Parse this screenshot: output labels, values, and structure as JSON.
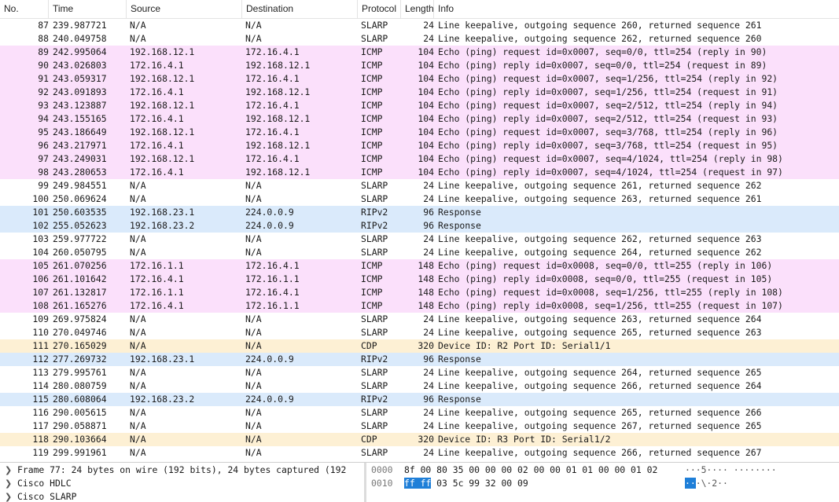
{
  "columns": {
    "no": "No.",
    "time": "Time",
    "source": "Source",
    "destination": "Destination",
    "protocol": "Protocol",
    "length": "Length",
    "info": "Info"
  },
  "colors": {
    "icmp": "#fbe0fb",
    "rip": "#daeafb",
    "cdp": "#fdf0d4",
    "slarp": "#ffffff",
    "selection": "#1f7fd8"
  },
  "packets": [
    {
      "no": "87",
      "time": "239.987721",
      "src": "N/A",
      "dst": "N/A",
      "proto": "SLARP",
      "len": "24",
      "info": "Line keepalive, outgoing sequence 260, returned sequence 261",
      "cls": "slarp"
    },
    {
      "no": "88",
      "time": "240.049758",
      "src": "N/A",
      "dst": "N/A",
      "proto": "SLARP",
      "len": "24",
      "info": "Line keepalive, outgoing sequence 262, returned sequence 260",
      "cls": "slarp"
    },
    {
      "no": "89",
      "time": "242.995064",
      "src": "192.168.12.1",
      "dst": "172.16.4.1",
      "proto": "ICMP",
      "len": "104",
      "info": "Echo (ping) request  id=0x0007, seq=0/0, ttl=254 (reply in 90)",
      "cls": "icmp"
    },
    {
      "no": "90",
      "time": "243.026803",
      "src": "172.16.4.1",
      "dst": "192.168.12.1",
      "proto": "ICMP",
      "len": "104",
      "info": "Echo (ping) reply    id=0x0007, seq=0/0, ttl=254 (request in 89)",
      "cls": "icmp"
    },
    {
      "no": "91",
      "time": "243.059317",
      "src": "192.168.12.1",
      "dst": "172.16.4.1",
      "proto": "ICMP",
      "len": "104",
      "info": "Echo (ping) request  id=0x0007, seq=1/256, ttl=254 (reply in 92)",
      "cls": "icmp"
    },
    {
      "no": "92",
      "time": "243.091893",
      "src": "172.16.4.1",
      "dst": "192.168.12.1",
      "proto": "ICMP",
      "len": "104",
      "info": "Echo (ping) reply    id=0x0007, seq=1/256, ttl=254 (request in 91)",
      "cls": "icmp"
    },
    {
      "no": "93",
      "time": "243.123887",
      "src": "192.168.12.1",
      "dst": "172.16.4.1",
      "proto": "ICMP",
      "len": "104",
      "info": "Echo (ping) request  id=0x0007, seq=2/512, ttl=254 (reply in 94)",
      "cls": "icmp"
    },
    {
      "no": "94",
      "time": "243.155165",
      "src": "172.16.4.1",
      "dst": "192.168.12.1",
      "proto": "ICMP",
      "len": "104",
      "info": "Echo (ping) reply    id=0x0007, seq=2/512, ttl=254 (request in 93)",
      "cls": "icmp"
    },
    {
      "no": "95",
      "time": "243.186649",
      "src": "192.168.12.1",
      "dst": "172.16.4.1",
      "proto": "ICMP",
      "len": "104",
      "info": "Echo (ping) request  id=0x0007, seq=3/768, ttl=254 (reply in 96)",
      "cls": "icmp"
    },
    {
      "no": "96",
      "time": "243.217971",
      "src": "172.16.4.1",
      "dst": "192.168.12.1",
      "proto": "ICMP",
      "len": "104",
      "info": "Echo (ping) reply    id=0x0007, seq=3/768, ttl=254 (request in 95)",
      "cls": "icmp"
    },
    {
      "no": "97",
      "time": "243.249031",
      "src": "192.168.12.1",
      "dst": "172.16.4.1",
      "proto": "ICMP",
      "len": "104",
      "info": "Echo (ping) request  id=0x0007, seq=4/1024, ttl=254 (reply in 98)",
      "cls": "icmp"
    },
    {
      "no": "98",
      "time": "243.280653",
      "src": "172.16.4.1",
      "dst": "192.168.12.1",
      "proto": "ICMP",
      "len": "104",
      "info": "Echo (ping) reply    id=0x0007, seq=4/1024, ttl=254 (request in 97)",
      "cls": "icmp"
    },
    {
      "no": "99",
      "time": "249.984551",
      "src": "N/A",
      "dst": "N/A",
      "proto": "SLARP",
      "len": "24",
      "info": "Line keepalive, outgoing sequence 261, returned sequence 262",
      "cls": "slarp"
    },
    {
      "no": "100",
      "time": "250.069624",
      "src": "N/A",
      "dst": "N/A",
      "proto": "SLARP",
      "len": "24",
      "info": "Line keepalive, outgoing sequence 263, returned sequence 261",
      "cls": "slarp"
    },
    {
      "no": "101",
      "time": "250.603535",
      "src": "192.168.23.1",
      "dst": "224.0.0.9",
      "proto": "RIPv2",
      "len": "96",
      "info": "Response",
      "cls": "rip"
    },
    {
      "no": "102",
      "time": "255.052623",
      "src": "192.168.23.2",
      "dst": "224.0.0.9",
      "proto": "RIPv2",
      "len": "96",
      "info": "Response",
      "cls": "rip"
    },
    {
      "no": "103",
      "time": "259.977722",
      "src": "N/A",
      "dst": "N/A",
      "proto": "SLARP",
      "len": "24",
      "info": "Line keepalive, outgoing sequence 262, returned sequence 263",
      "cls": "slarp"
    },
    {
      "no": "104",
      "time": "260.050795",
      "src": "N/A",
      "dst": "N/A",
      "proto": "SLARP",
      "len": "24",
      "info": "Line keepalive, outgoing sequence 264, returned sequence 262",
      "cls": "slarp"
    },
    {
      "no": "105",
      "time": "261.070256",
      "src": "172.16.1.1",
      "dst": "172.16.4.1",
      "proto": "ICMP",
      "len": "148",
      "info": "Echo (ping) request  id=0x0008, seq=0/0, ttl=255 (reply in 106)",
      "cls": "icmp"
    },
    {
      "no": "106",
      "time": "261.101642",
      "src": "172.16.4.1",
      "dst": "172.16.1.1",
      "proto": "ICMP",
      "len": "148",
      "info": "Echo (ping) reply    id=0x0008, seq=0/0, ttl=255 (request in 105)",
      "cls": "icmp"
    },
    {
      "no": "107",
      "time": "261.132817",
      "src": "172.16.1.1",
      "dst": "172.16.4.1",
      "proto": "ICMP",
      "len": "148",
      "info": "Echo (ping) request  id=0x0008, seq=1/256, ttl=255 (reply in 108)",
      "cls": "icmp"
    },
    {
      "no": "108",
      "time": "261.165276",
      "src": "172.16.4.1",
      "dst": "172.16.1.1",
      "proto": "ICMP",
      "len": "148",
      "info": "Echo (ping) reply    id=0x0008, seq=1/256, ttl=255 (request in 107)",
      "cls": "icmp"
    },
    {
      "no": "109",
      "time": "269.975824",
      "src": "N/A",
      "dst": "N/A",
      "proto": "SLARP",
      "len": "24",
      "info": "Line keepalive, outgoing sequence 263, returned sequence 264",
      "cls": "slarp"
    },
    {
      "no": "110",
      "time": "270.049746",
      "src": "N/A",
      "dst": "N/A",
      "proto": "SLARP",
      "len": "24",
      "info": "Line keepalive, outgoing sequence 265, returned sequence 263",
      "cls": "slarp"
    },
    {
      "no": "111",
      "time": "270.165029",
      "src": "N/A",
      "dst": "N/A",
      "proto": "CDP",
      "len": "320",
      "info": "Device ID: R2  Port ID: Serial1/1",
      "cls": "cdp"
    },
    {
      "no": "112",
      "time": "277.269732",
      "src": "192.168.23.1",
      "dst": "224.0.0.9",
      "proto": "RIPv2",
      "len": "96",
      "info": "Response",
      "cls": "rip"
    },
    {
      "no": "113",
      "time": "279.995761",
      "src": "N/A",
      "dst": "N/A",
      "proto": "SLARP",
      "len": "24",
      "info": "Line keepalive, outgoing sequence 264, returned sequence 265",
      "cls": "slarp"
    },
    {
      "no": "114",
      "time": "280.080759",
      "src": "N/A",
      "dst": "N/A",
      "proto": "SLARP",
      "len": "24",
      "info": "Line keepalive, outgoing sequence 266, returned sequence 264",
      "cls": "slarp"
    },
    {
      "no": "115",
      "time": "280.608064",
      "src": "192.168.23.2",
      "dst": "224.0.0.9",
      "proto": "RIPv2",
      "len": "96",
      "info": "Response",
      "cls": "rip"
    },
    {
      "no": "116",
      "time": "290.005615",
      "src": "N/A",
      "dst": "N/A",
      "proto": "SLARP",
      "len": "24",
      "info": "Line keepalive, outgoing sequence 265, returned sequence 266",
      "cls": "slarp"
    },
    {
      "no": "117",
      "time": "290.058871",
      "src": "N/A",
      "dst": "N/A",
      "proto": "SLARP",
      "len": "24",
      "info": "Line keepalive, outgoing sequence 267, returned sequence 265",
      "cls": "slarp"
    },
    {
      "no": "118",
      "time": "290.103664",
      "src": "N/A",
      "dst": "N/A",
      "proto": "CDP",
      "len": "320",
      "info": "Device ID: R3  Port ID: Serial1/2",
      "cls": "cdp"
    },
    {
      "no": "119",
      "time": "299.991961",
      "src": "N/A",
      "dst": "N/A",
      "proto": "SLARP",
      "len": "24",
      "info": "Line keepalive, outgoing sequence 266, returned sequence 267",
      "cls": "slarp"
    }
  ],
  "details": [
    {
      "icon": "chevron-right-icon",
      "text": "Frame 77: 24 bytes on wire (192 bits), 24 bytes captured (192"
    },
    {
      "icon": "chevron-right-icon",
      "text": "Cisco HDLC"
    },
    {
      "icon": "chevron-right-icon",
      "text": "Cisco SLARP"
    }
  ],
  "hexdump": [
    {
      "offset": "0000",
      "sel_bytes": "",
      "bytes": "8f 00 80 35 00 00 00 02  00 00 01 01 00 00 01 02",
      "sel_ascii": "",
      "ascii": "···5···· ········"
    },
    {
      "offset": "0010",
      "sel_bytes": "ff ff",
      "bytes": " 03 5c 99 32 00 09",
      "sel_ascii": "··",
      "ascii": "·\\·2··"
    }
  ]
}
